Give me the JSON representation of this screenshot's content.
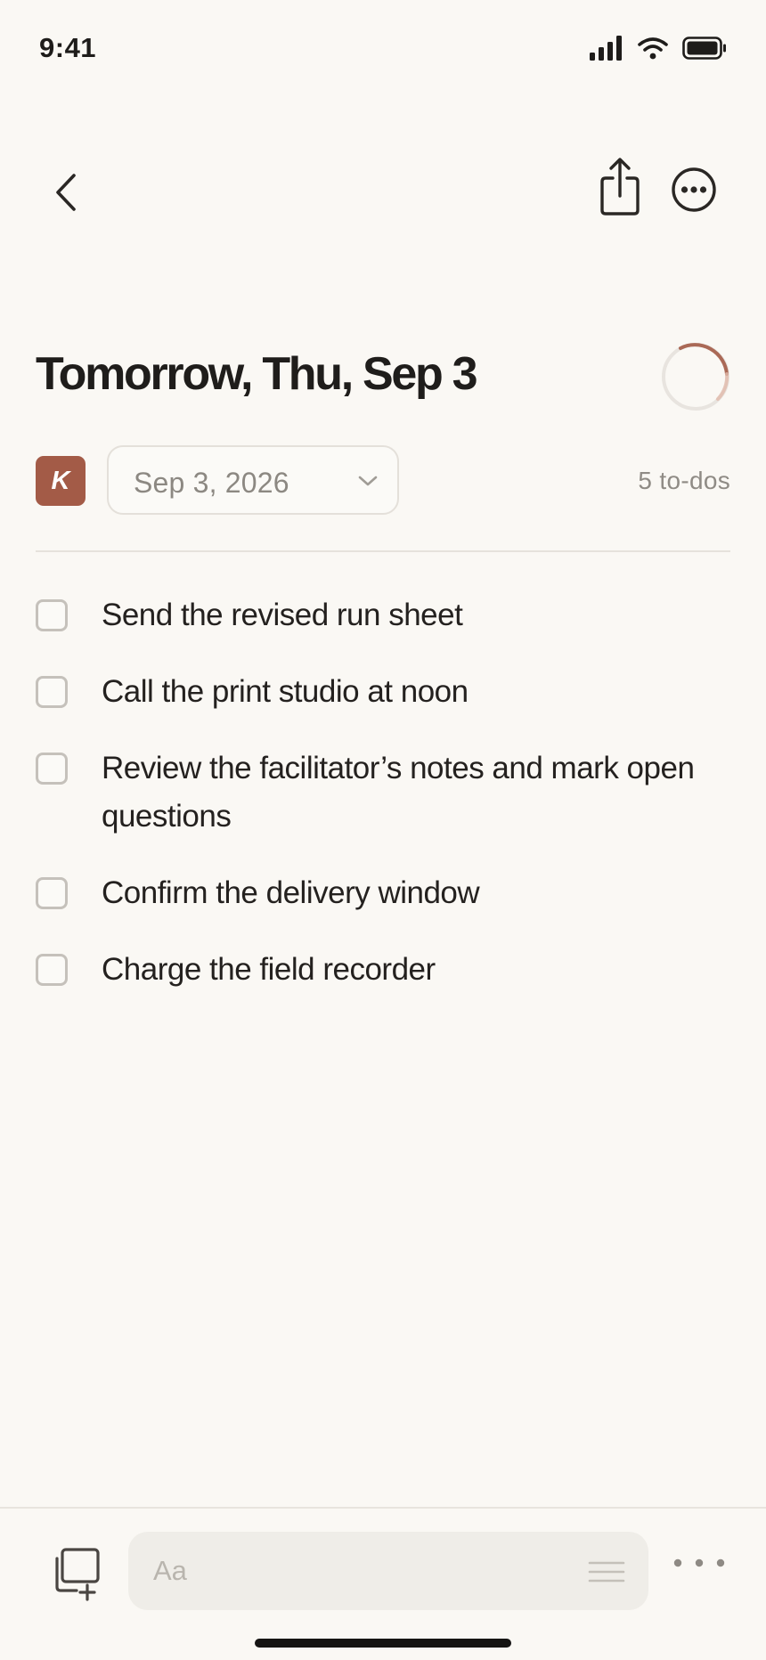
{
  "status_bar": {
    "time": "9:41",
    "icons": [
      "signal-icon",
      "wifi-icon",
      "battery-icon"
    ]
  },
  "nav": {
    "back_icon": "chevron-left-icon",
    "share_icon": "share-icon",
    "more_icon": "ellipsis-circle-icon"
  },
  "header": {
    "title": "Tomorrow, Thu, Sep 3",
    "progress_icon": "progress-ring-icon"
  },
  "meta": {
    "avatar_initial": "K",
    "date_value": "Sep 3, 2026",
    "todo_count": "5 to-dos"
  },
  "todos": [
    {
      "text": "Send the revised run sheet",
      "done": false
    },
    {
      "text": "Call the print studio at noon",
      "done": false
    },
    {
      "text": "Review the facilitator’s notes and mark open questions",
      "done": false
    },
    {
      "text": "Confirm the delivery window",
      "done": false
    },
    {
      "text": "Charge the field recorder",
      "done": false
    }
  ],
  "composer": {
    "placeholder": "Aa",
    "new_note_icon": "new-note-icon",
    "format_icon": "text-format-icon",
    "overflow_icon": "more-horizontal-icon"
  },
  "colors": {
    "background": "#faf8f4",
    "accent": "#a35b47",
    "text": "#1f1d1b",
    "muted": "#8f8b85"
  }
}
